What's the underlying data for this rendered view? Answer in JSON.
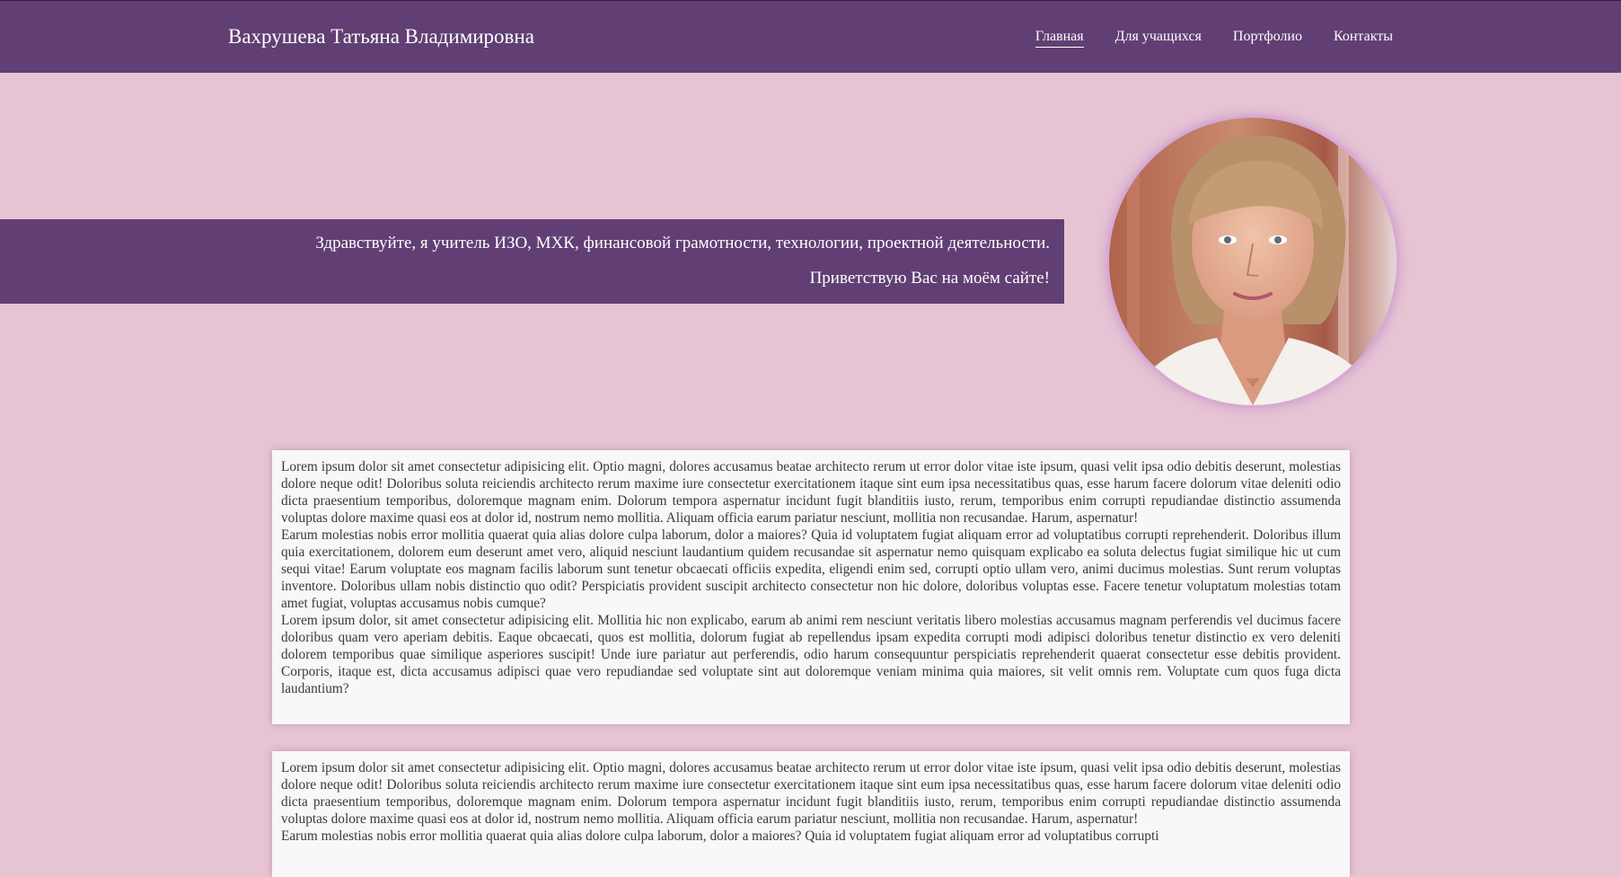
{
  "header": {
    "site_title": "Вахрушева Татьяна Владимировна",
    "nav": [
      {
        "label": "Главная",
        "active": true
      },
      {
        "label": "Для учащихся",
        "active": false
      },
      {
        "label": "Портфолио",
        "active": false
      },
      {
        "label": "Контакты",
        "active": false
      }
    ]
  },
  "hero": {
    "line1": "Здравствуйте, я учитель ИЗО, МХК, финансовой грамотности, технологии, проектной деятельности.",
    "line2": "Приветствую Вас на моём сайте!"
  },
  "cards": [
    {
      "paragraphs": [
        "Lorem ipsum dolor sit amet consectetur adipisicing elit. Optio magni, dolores accusamus beatae architecto rerum ut error dolor vitae iste ipsum, quasi velit ipsa odio debitis deserunt, molestias dolore neque odit! Doloribus soluta reiciendis architecto rerum maxime iure consectetur exercitationem itaque sint eum ipsa necessitatibus quas, esse harum facere dolorum vitae deleniti odio dicta praesentium temporibus, doloremque magnam enim. Dolorum tempora aspernatur incidunt fugit blanditiis iusto, rerum, temporibus enim corrupti repudiandae distinctio assumenda voluptas dolore maxime quasi eos at dolor id, nostrum nemo mollitia. Aliquam officia earum pariatur nesciunt, mollitia non recusandae. Harum, aspernatur!",
        "Earum molestias nobis error mollitia quaerat quia alias dolore culpa laborum, dolor a maiores? Quia id voluptatem fugiat aliquam error ad voluptatibus corrupti reprehenderit. Doloribus illum quia exercitationem, dolorem eum deserunt amet vero, aliquid nesciunt laudantium quidem recusandae sit aspernatur nemo quisquam explicabo ea soluta delectus fugiat similique hic ut cum sequi vitae! Earum voluptate eos magnam facilis laborum sunt tenetur obcaecati officiis expedita, eligendi enim sed, corrupti optio ullam vero, animi ducimus molestias. Sunt rerum voluptas inventore. Doloribus ullam nobis distinctio quo odit? Perspiciatis provident suscipit architecto consectetur non hic dolore, doloribus voluptas esse. Facere tenetur voluptatum molestias totam amet fugiat, voluptas accusamus nobis cumque?",
        "Lorem ipsum dolor, sit amet consectetur adipisicing elit. Mollitia hic non explicabo, earum ab animi rem nesciunt veritatis libero molestias accusamus magnam perferendis vel ducimus facere doloribus quam vero aperiam debitis. Eaque obcaecati, quos est mollitia, dolorum fugiat ab repellendus ipsam expedita corrupti modi adipisci doloribus tenetur distinctio ex vero deleniti dolorem temporibus quae similique asperiores suscipit! Unde iure pariatur aut perferendis, odio harum consequuntur perspiciatis reprehenderit quaerat consectetur esse debitis provident. Corporis, itaque est, dicta accusamus adipisci quae vero repudiandae sed voluptate sint aut doloremque veniam minima quia maiores, sit velit omnis rem. Voluptate cum quos fuga dicta laudantium?"
      ]
    },
    {
      "paragraphs": [
        "Lorem ipsum dolor sit amet consectetur adipisicing elit. Optio magni, dolores accusamus beatae architecto rerum ut error dolor vitae iste ipsum, quasi velit ipsa odio debitis deserunt, molestias dolore neque odit! Doloribus soluta reiciendis architecto rerum maxime iure consectetur exercitationem itaque sint eum ipsa necessitatibus quas, esse harum facere dolorum vitae deleniti odio dicta praesentium temporibus, doloremque magnam enim. Dolorum tempora aspernatur incidunt fugit blanditiis iusto, rerum, temporibus enim corrupti repudiandae distinctio assumenda voluptas dolore maxime quasi eos at dolor id, nostrum nemo mollitia. Aliquam officia earum pariatur nesciunt, mollitia non recusandae. Harum, aspernatur!",
        "Earum molestias nobis error mollitia quaerat quia alias dolore culpa laborum, dolor a maiores? Quia id voluptatem fugiat aliquam error ad voluptatibus corrupti"
      ]
    }
  ],
  "colors": {
    "header_bg": "#613f74",
    "page_bg": "#e6c4d4",
    "card_bg": "#f8f8f8"
  }
}
